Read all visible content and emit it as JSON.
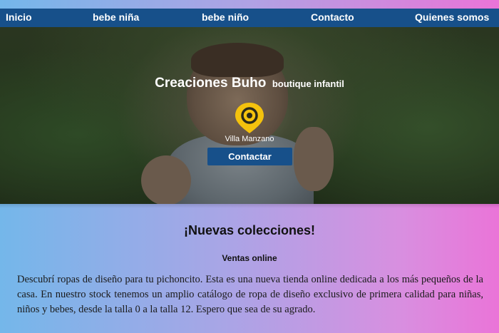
{
  "nav": {
    "items": [
      {
        "label": "Inicio"
      },
      {
        "label": "bebe niña"
      },
      {
        "label": "bebe niño"
      },
      {
        "label": "Contacto"
      },
      {
        "label": "Quienes somos"
      }
    ],
    "background": "#17508a"
  },
  "hero": {
    "brand": "Creaciones Buho",
    "tagline": "boutique infantil",
    "pin_icon": "map-pin-icon",
    "pin_color": "#f4c20d",
    "location": "Villa Manzano",
    "cta_label": "Contactar"
  },
  "content": {
    "title": "¡Nuevas colecciones!",
    "subtitle": "Ventas online",
    "body": "Descubrí ropas de diseño para tu pichoncito. Esta es una nueva tienda online dedicada a los más pequeños de la casa. En nuestro stock tenemos un amplio catálogo de ropa de diseño exclusivo de primera calidad para niñas, niños y bebes, desde la talla 0 a la talla 12. Espero que sea de su agrado."
  },
  "colors": {
    "gradient_left": "#74b7ea",
    "gradient_right": "#ea74d8"
  }
}
